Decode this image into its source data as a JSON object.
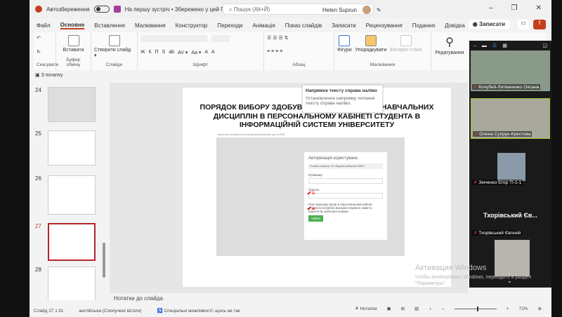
{
  "titlebar": {
    "autosave": "Автозбереження",
    "doc_title": "На першу зустріч • Збережено у цей ПК ⌄",
    "search_placeholder": "Пошук (Alt+Й)",
    "user": "Helen Suprun"
  },
  "tabs": [
    "Файл",
    "Основне",
    "Вставлення",
    "Малювання",
    "Конструктор",
    "Переходи",
    "Анімація",
    "Показ слайдів",
    "Записати",
    "Рецензування",
    "Подання",
    "Довідка"
  ],
  "record_button": "◉ Записати",
  "ribbon": {
    "undo_group": "Скасувати",
    "clipboard": {
      "paste": "Вставити",
      "label": "Буфер обміну"
    },
    "slides": {
      "new_slide": "Створити слайд ▾",
      "label": "Слайди"
    },
    "font": {
      "label": "Шрифт",
      "buttons": [
        "Ж",
        "К",
        "П",
        "S",
        "ab",
        "AV ▾",
        "Aa ▾",
        "A",
        "A"
      ]
    },
    "paragraph": {
      "label": "Абзац"
    },
    "drawing": {
      "shapes": "Фігури",
      "arrange": "Упорядкувати",
      "quick_styles": "Експрес-стилі",
      "label": "Малювання"
    },
    "editing": "Редагування"
  },
  "qat": "З початку",
  "thumbnails": [
    {
      "num": "24"
    },
    {
      "num": "25"
    },
    {
      "num": "26"
    },
    {
      "num": "27",
      "selected": true
    },
    {
      "num": "28"
    }
  ],
  "tooltip": {
    "title": "Напрямок тексту справа наліво",
    "body": "Установлення напрямку читання тексту справа наліво."
  },
  "slide": {
    "title": "ПОРЯДОК  ВИБОРУ  ЗДОБУВАЧАМИ ВИБІРКОВИХ НАВЧАЛЬНИХ ДИСЦИПЛІН В ПЕРСОНАЛЬНОМУ КАБІНЕТІ СТУДЕНТА В ІНФОРМАЦІЙНІЙ СИСТЕМІ УНІВЕРСИТЕТУ",
    "url": "https://ntu.kharkiv.edu.ua/cgi-bin/classman.cgi?n=999",
    "auth_title": "Авторизація користувача",
    "breadcrumb": "Головна сторінка › ІС «Журнал успішності Web»",
    "surname_label": "Прізвище",
    "password_label": "Пароль",
    "hint": "При першому вході в персональний кабінет студента потрібно використовувати замість пароля № залікової книжки",
    "login_button": "Увійти"
  },
  "notes_placeholder": "Нотатки до слайда",
  "status": {
    "slide": "Слайд 27 з 31",
    "language": "англійська (Сполучені Штати)",
    "accessibility": "Спеціальні можливості: щось не так",
    "notes": "Нотатки",
    "zoom": "72%",
    "zoom_value": 72
  },
  "watermark": {
    "line1": "Активация Windows",
    "line2": "Чтобы активировать Windows, перейдите в раздел \"Параметры\"."
  },
  "zoom_panel": {
    "participants": [
      "Кочубей-Литвиненко Оксана",
      "Олена Супрун-Крестова",
      "Зінченко Єгор ТІ-1-1",
      "Тхорівський Євгеній"
    ],
    "big_name": "Тхорівський Єв..."
  },
  "colors": {
    "accent": "#c43e1c",
    "selected_thumb": "#b4262d"
  }
}
